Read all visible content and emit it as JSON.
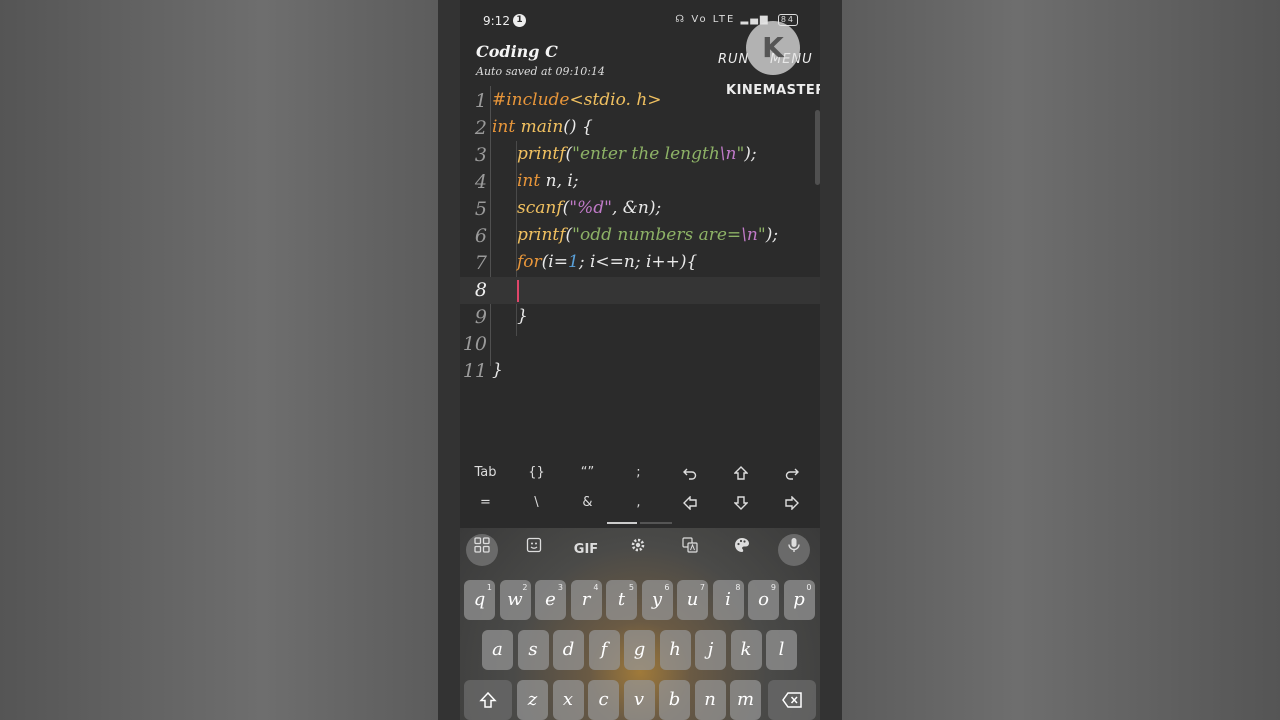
{
  "status_bar": {
    "time": "9:12",
    "notification_count": "1",
    "network": "Vo LTE",
    "battery": "84"
  },
  "app": {
    "title": "Coding C",
    "autosave": "Auto saved at 09:10:14",
    "run_label": "RUN",
    "menu_label": "MENU"
  },
  "watermark": {
    "logo_letter": "K",
    "brand": "KINEMASTER"
  },
  "editor": {
    "active_line": 8,
    "lines": [
      {
        "num": "1",
        "indent": 0
      },
      {
        "num": "2",
        "indent": 0
      },
      {
        "num": "3",
        "indent": 1
      },
      {
        "num": "4",
        "indent": 1
      },
      {
        "num": "5",
        "indent": 1
      },
      {
        "num": "6",
        "indent": 1
      },
      {
        "num": "7",
        "indent": 1
      },
      {
        "num": "8",
        "indent": 1
      },
      {
        "num": "9",
        "indent": 1
      },
      {
        "num": "10",
        "indent": 0
      },
      {
        "num": "11",
        "indent": 0
      }
    ],
    "tokens": {
      "l1_a": "#include",
      "l1_b": "<stdio. h>",
      "l2_a": "int",
      "l2_b": "main",
      "l2_c": "() {",
      "l3_a": "printf",
      "l3_b": "(",
      "l3_c": "\"enter the length",
      "l3_d": "\\n",
      "l3_e": "\"",
      "l3_f": ");",
      "l4_a": "int",
      "l4_b": " n, i;",
      "l5_a": "scanf",
      "l5_b": "(",
      "l5_c": "\"%d\"",
      "l5_d": ", &n);",
      "l6_a": "printf",
      "l6_b": "(",
      "l6_c": "\"odd numbers are=",
      "l6_d": "\\n",
      "l6_e": "\"",
      "l6_f": ");",
      "l7_a": "for",
      "l7_b": "(i=",
      "l7_c": "1",
      "l7_d": "; i<=n; i++){",
      "l9_a": "}",
      "l11_a": "}"
    }
  },
  "symbols": {
    "row1": [
      "Tab",
      "{}",
      "“”",
      ";",
      "undo-icon",
      "arrow-up-icon",
      "redo-icon"
    ],
    "row2": [
      "=",
      "\\",
      "&",
      ",",
      "arrow-left-icon",
      "arrow-down-icon",
      "arrow-right-icon"
    ]
  },
  "keyboard": {
    "toolbar": [
      "apps-icon",
      "sticker-icon",
      "GIF",
      "settings-icon",
      "translate-icon",
      "palette-icon",
      "mic-icon"
    ],
    "row1": [
      [
        "q",
        "1"
      ],
      [
        "w",
        "2"
      ],
      [
        "e",
        "3"
      ],
      [
        "r",
        "4"
      ],
      [
        "t",
        "5"
      ],
      [
        "y",
        "6"
      ],
      [
        "u",
        "7"
      ],
      [
        "i",
        "8"
      ],
      [
        "o",
        "9"
      ],
      [
        "p",
        "0"
      ]
    ],
    "row2": [
      "a",
      "s",
      "d",
      "f",
      "g",
      "h",
      "j",
      "k",
      "l"
    ],
    "row3": [
      "z",
      "x",
      "c",
      "v",
      "b",
      "n",
      "m"
    ]
  }
}
